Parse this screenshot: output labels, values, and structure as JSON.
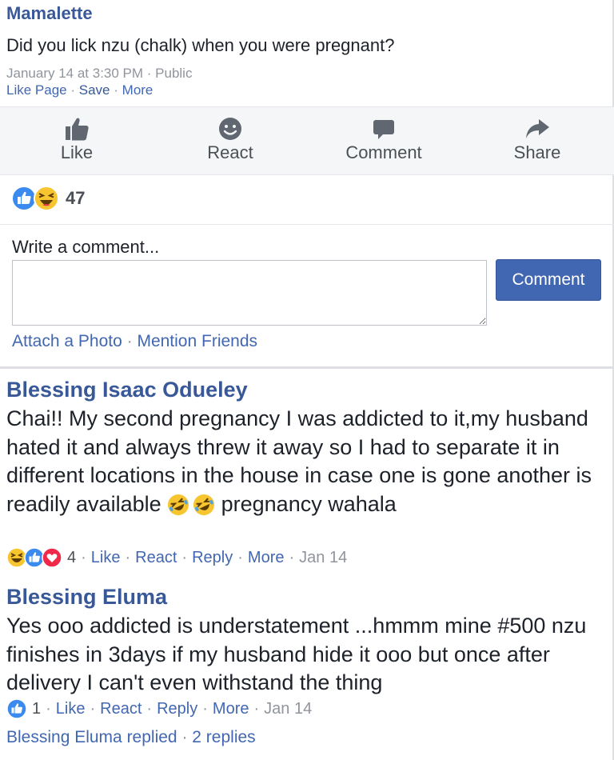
{
  "post": {
    "author": "Mamalette",
    "text": "Did you lick nzu (chalk) when you were pregnant?",
    "meta_date": "January 14 at 3:30 PM",
    "meta_sep": " · ",
    "meta_privacy": "Public",
    "links": {
      "like_page": "Like Page",
      "save": "Save",
      "more": "More"
    }
  },
  "actions": [
    {
      "label": "Like",
      "icon": "thumbs-up-icon"
    },
    {
      "label": "React",
      "icon": "smiley-icon"
    },
    {
      "label": "Comment",
      "icon": "speech-bubble-icon"
    },
    {
      "label": "Share",
      "icon": "share-arrow-icon"
    }
  ],
  "reactions": {
    "count": "47",
    "icons": [
      "like-reaction-icon",
      "haha-reaction-icon"
    ]
  },
  "comment_form": {
    "label": "Write a comment...",
    "placeholder": "",
    "submit": "Comment",
    "attach_photo": "Attach a Photo",
    "mention_friends": "Mention Friends"
  },
  "comments": [
    {
      "author": "Blessing Isaac Odueley",
      "text_before": "Chai!! My second pregnancy I was addicted to it,my husband hated it and always threw it away so I had to separate it in different locations in the house in case one is gone another is readily available ",
      "text_after": " pregnancy wahala",
      "inline_icons": [
        "rofl-emoji-icon",
        "rofl-emoji-icon"
      ],
      "reaction_icons": [
        "haha-reaction-icon",
        "like-reaction-icon",
        "love-reaction-icon"
      ],
      "reaction_count": "4",
      "like": "Like",
      "react": "React",
      "reply": "Reply",
      "more": "More",
      "date": "Jan 14"
    },
    {
      "author": "Blessing Eluma",
      "text": "Yes ooo addicted is understatement ...hmmm mine #500 nzu finishes in 3days if my husband hide it ooo but once after delivery I can't even withstand the thing",
      "reaction_icons": [
        "like-reaction-icon"
      ],
      "reaction_count": "1",
      "like": "Like",
      "react": "React",
      "reply": "Reply",
      "more": "More",
      "date": "Jan 14",
      "replied_by": "Blessing Eluma replied",
      "replies_count": "2 replies"
    }
  ],
  "colors": {
    "brand": "#4267b2",
    "author": "#385898",
    "action_bg": "#f5f6f7",
    "muted": "#90949c"
  }
}
